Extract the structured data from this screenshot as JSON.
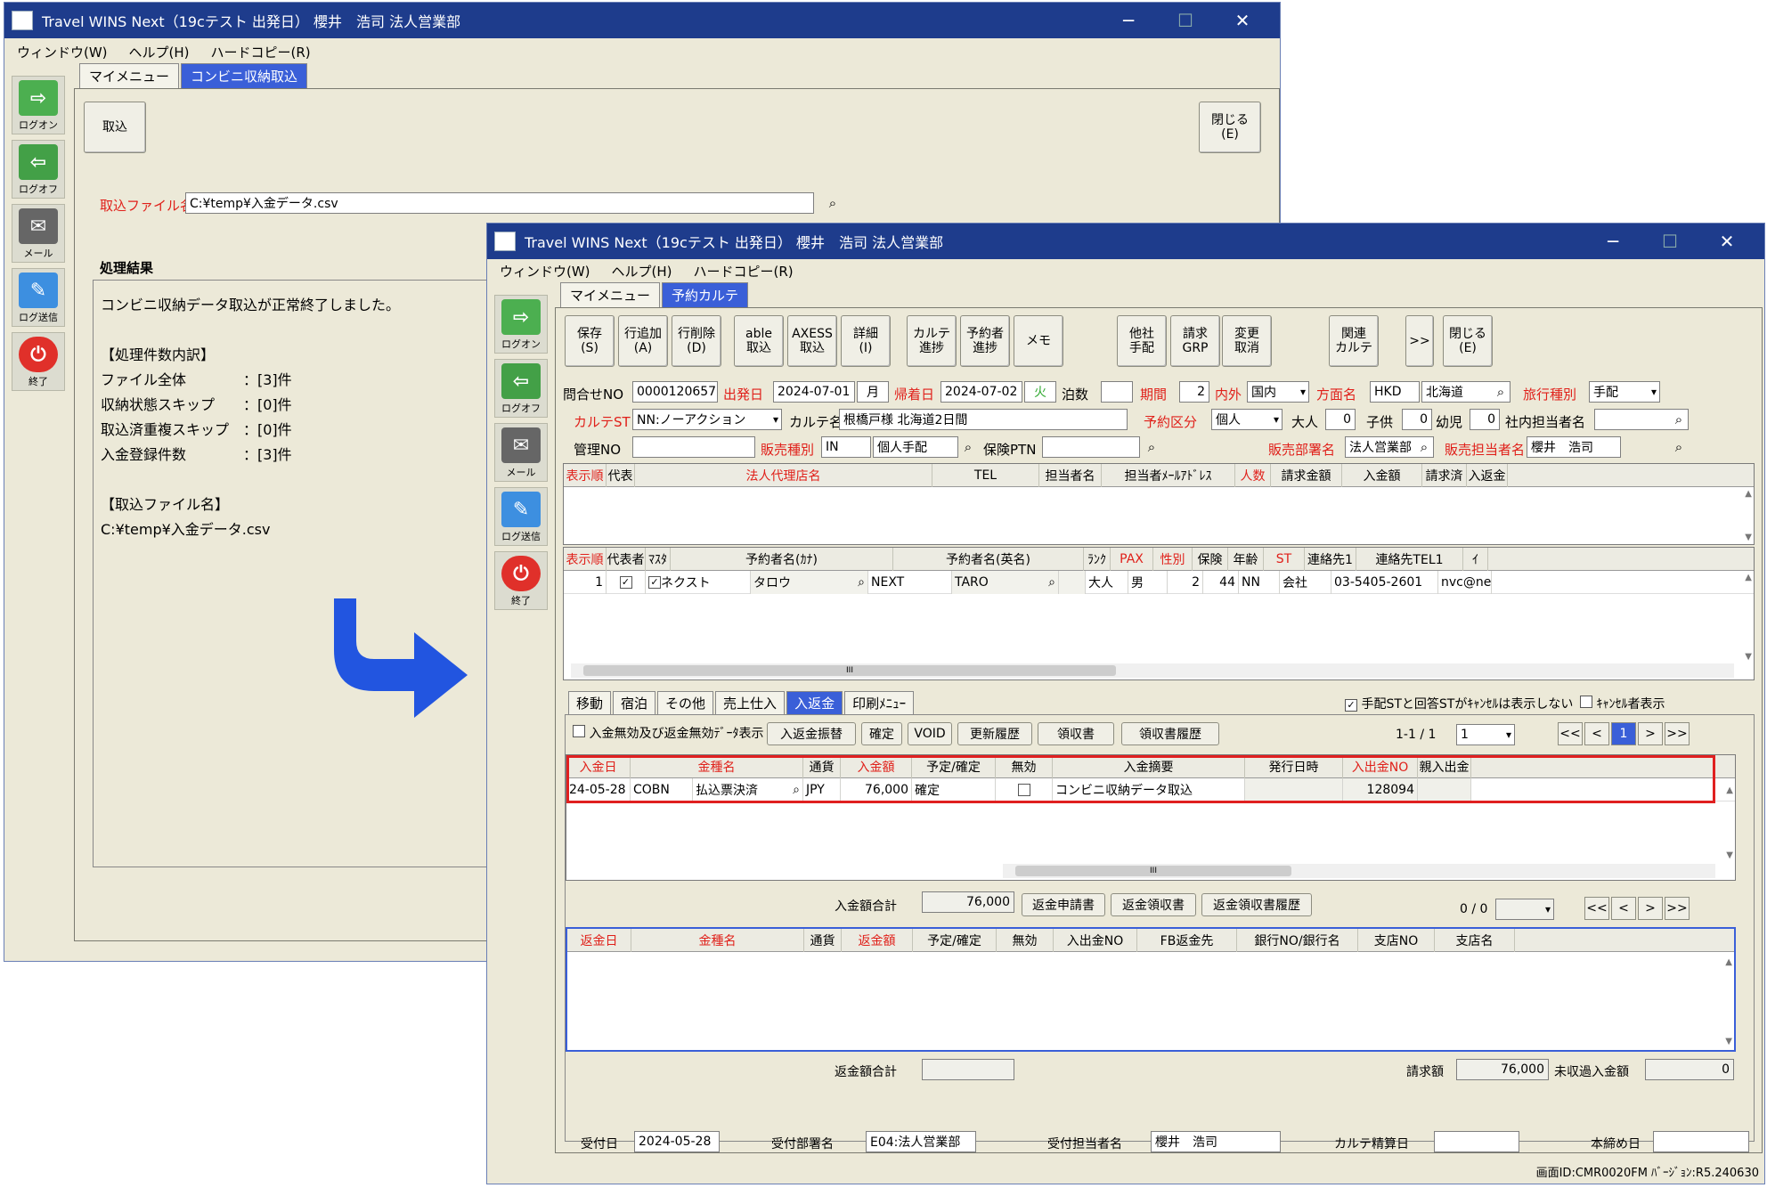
{
  "back_window": {
    "title": "Travel WINS Next（19cテスト 出発日） 櫻井　浩司 法人営業部",
    "menu": [
      "ウィンドウ(W)",
      "ヘルプ(H)",
      "ハードコピー(R)"
    ],
    "tabs": [
      "マイメニュー",
      "コンビニ収納取込"
    ],
    "import_button": "取込",
    "close_button": [
      "閉じる",
      "(E)"
    ],
    "file_label": "取込ファイル名",
    "file_value": "C:¥temp¥入金データ.csv",
    "result_label": "処理結果",
    "result_lines": [
      "コンビニ収納データ取込が正常終了しました。",
      "",
      "【処理件数内訳】",
      "ファイル全体　　　　：[3]件",
      "収納状態スキップ　　：[0]件",
      "取込済重複スキップ　：[0]件",
      "入金登録件数　　　　：[3]件",
      "",
      "【取込ファイル名】",
      "C:¥temp¥入金データ.csv"
    ]
  },
  "sidebar": [
    {
      "label": "ログオン",
      "icon": "logon-icon"
    },
    {
      "label": "ログオフ",
      "icon": "logoff-icon"
    },
    {
      "label": "メール",
      "icon": "mail-icon"
    },
    {
      "label": "ログ送信",
      "icon": "log-send-icon"
    },
    {
      "label": "終了",
      "icon": "power-icon"
    }
  ],
  "front_window": {
    "title": "Travel WINS Next（19cテスト 出発日） 櫻井　浩司 法人営業部",
    "menu": [
      "ウィンドウ(W)",
      "ヘルプ(H)",
      "ハードコピー(R)"
    ],
    "tabs": [
      "マイメニュー",
      "予約カルテ"
    ],
    "toolbar": [
      [
        "保存",
        "(S)"
      ],
      [
        "行追加",
        "(A)"
      ],
      [
        "行削除",
        "(D)"
      ],
      [
        "able",
        "取込"
      ],
      [
        "AXESS",
        "取込"
      ],
      [
        "詳細",
        "(I)"
      ],
      [
        "カルテ",
        "進捗"
      ],
      [
        "予約者",
        "進捗"
      ],
      [
        "メモ",
        ""
      ],
      [
        "他社",
        "手配"
      ],
      [
        "請求",
        "GRP"
      ],
      [
        "変更",
        "取消"
      ],
      [
        "関連",
        "カルテ"
      ],
      [
        ">>",
        ""
      ],
      [
        "閉じる",
        "(E)"
      ]
    ],
    "form": {
      "inquiry_no_label": "問合せNO",
      "inquiry_no": "0000120657",
      "depart_label": "出発日",
      "depart_date": "2024-07-01",
      "depart_dow": "月",
      "return_label": "帰着日",
      "return_date": "2024-07-02",
      "return_dow": "火",
      "nights_label": "泊数",
      "nights": "",
      "period_label": "期間",
      "period": "2",
      "domestic_label": "内外",
      "domestic": "国内",
      "direction_label": "方面名",
      "direction_code": "HKD",
      "direction_name": "北海道",
      "travel_type_label": "旅行種別",
      "travel_type": "手配",
      "karte_st_label": "カルテST",
      "karte_st": "NN:ノーアクション",
      "karte_name_label": "カルテ名",
      "karte_name": "根橋戸様 北海道2日間",
      "booking_type_label": "予約区分",
      "booking_type": "個人",
      "adult_label": "大人",
      "adult": "0",
      "child_label": "子供",
      "child": "0",
      "infant_label": "幼児",
      "infant": "0",
      "staff_label": "社内担当者名",
      "staff": "",
      "mgmt_no_label": "管理NO",
      "mgmt_no": "",
      "sales_type_label": "販売種別",
      "sales_type_code": "IN",
      "sales_type_name": "個人手配",
      "insurance_label": "保険PTN",
      "insurance": "",
      "sales_dept_label": "販売部署名",
      "sales_dept": "法人営業部",
      "sales_staff_label": "販売担当者名",
      "sales_staff": "櫻井　浩司"
    },
    "agency_grid": {
      "headers": [
        "表示順",
        "代表",
        "法人代理店名",
        "TEL",
        "担当者名",
        "担当者ﾒｰﾙｱﾄﾞﾚｽ",
        "人数",
        "請求金額",
        "入金額",
        "請求済",
        "入返金"
      ]
    },
    "traveler_grid": {
      "headers": [
        "表示順",
        "代表者",
        "ﾏｽﾀ",
        "予約者名(ｶﾅ)",
        "予約者名(英名)",
        "ﾗﾝｸ",
        "PAX",
        "性別",
        "保険",
        "年齢",
        "ST",
        "連絡先1",
        "連絡先TEL1",
        "ｲ"
      ],
      "rows": [
        {
          "order": "1",
          "kana_last": "ネクスト",
          "kana_first": "タロウ",
          "en_last": "NEXT",
          "en_first": "TARO",
          "pax": "大人",
          "sex": "男",
          "insurance": "2",
          "age": "44",
          "st": "NN",
          "contact": "会社",
          "tel": "03-5405-2601",
          "email": "nvc@nex"
        }
      ],
      "scroll_thumb": "III"
    },
    "sub_tabs": [
      "移動",
      "宿泊",
      "その他",
      "売上仕入",
      "入返金",
      "印刷ﾒﾆｭｰ"
    ],
    "hide_cancel_label": "手配STと回答STがｷｬﾝｾﾙは表示しない",
    "show_cancel_label": "ｷｬﾝｾﾙ者表示",
    "invalid_check_label": "入金無効及び返金無効ﾃﾞｰﾀ表示",
    "deposit_buttons": [
      "入返金振替",
      "確定",
      "VOID",
      "更新履歴",
      "領収書",
      "領収書履歴"
    ],
    "pager": {
      "text": "1-1 / 1",
      "page": "1",
      "nav": [
        "<<",
        "<",
        "1",
        ">",
        ">>"
      ]
    },
    "deposit_grid": {
      "headers": [
        "入金日",
        "金種名",
        "通貨",
        "入金額",
        "予定/確定",
        "無効",
        "入金摘要",
        "発行日時",
        "入出金NO",
        "親入出金"
      ],
      "rows": [
        {
          "date": "24-05-28",
          "code": "COBN",
          "kind": "払込票決済",
          "currency": "JPY",
          "amount": "76,000",
          "status": "確定",
          "memo": "コンビニ収納データ取込",
          "issued": "",
          "no": "128094"
        }
      ]
    },
    "deposit_total_label": "入金額合計",
    "deposit_total": "76,000",
    "refund_buttons": [
      "返金申請書",
      "返金領収書",
      "返金領収書履歴"
    ],
    "refund_pager": {
      "text": "0 / 0",
      "nav": [
        "<<",
        "<",
        ">",
        ">>"
      ]
    },
    "refund_grid": {
      "headers": [
        "返金日",
        "金種名",
        "通貨",
        "返金額",
        "予定/確定",
        "無効",
        "入出金NO",
        "FB返金先",
        "銀行NO/銀行名",
        "支店NO",
        "支店名"
      ]
    },
    "refund_total_label": "返金額合計",
    "refund_total": "",
    "billing_label": "請求額",
    "billing": "76,000",
    "unpaid_label": "未収過入金額",
    "unpaid": "0",
    "footer": {
      "accept_date_label": "受付日",
      "accept_date": "2024-05-28",
      "accept_dept_label": "受付部署名",
      "accept_dept": "E04:法人営業部",
      "accept_staff_label": "受付担当者名",
      "accept_staff": "櫻井　浩司",
      "settle_label": "カルテ精算日",
      "settle": "",
      "close_label": "本締め日",
      "close": ""
    },
    "status_bar": "画面ID:CMR0020FM ﾊﾞｰｼﾞｮﾝ:R5.240630"
  },
  "colors": {
    "accent": "#3a5fd8",
    "title": "#1e3c8c",
    "required": "#e0201a",
    "arrow": "#2255e0",
    "highlight": "#e02020"
  }
}
